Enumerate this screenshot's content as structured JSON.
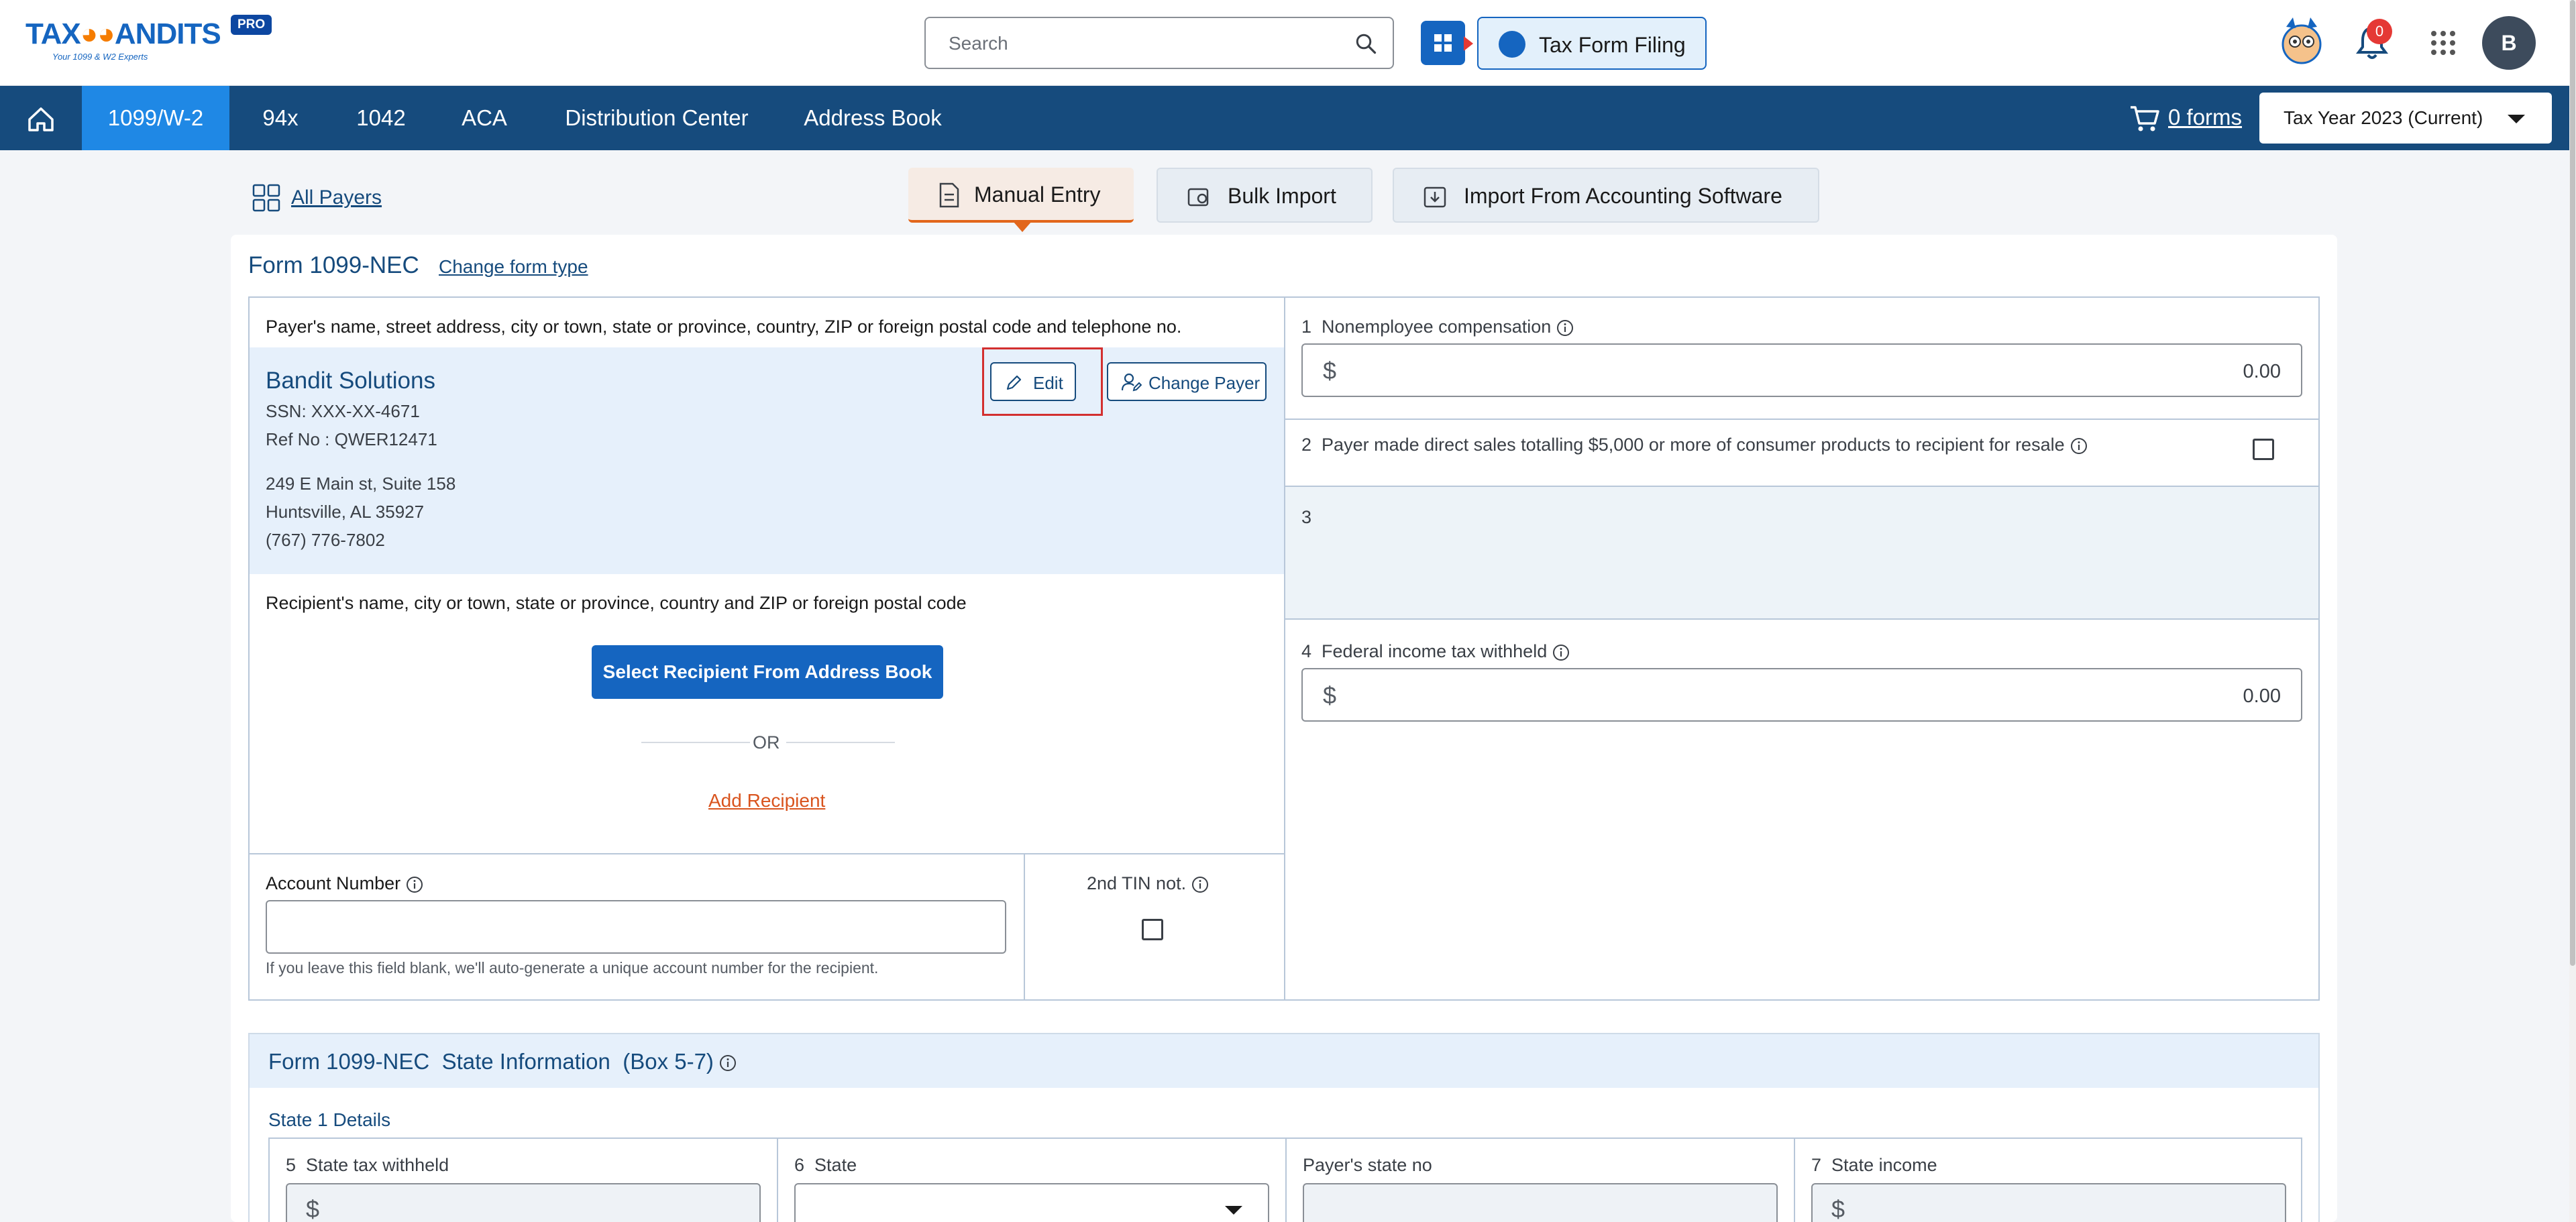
{
  "header": {
    "logo_text_left": "TAX",
    "logo_text_right": "ANDITS",
    "logo_tagline": "Your 1099 & W2 Experts",
    "pro_badge": "PRO",
    "search_placeholder": "Search",
    "tax_form_filing_label": "Tax Form Filing",
    "notification_count": "0",
    "avatar_initial": "B"
  },
  "nav": {
    "items": [
      {
        "label": "1099/W-2",
        "active": true
      },
      {
        "label": "94x"
      },
      {
        "label": "1042"
      },
      {
        "label": "ACA"
      },
      {
        "label": "Distribution Center"
      },
      {
        "label": "Address Book"
      }
    ],
    "cart_label": "0 forms",
    "tax_year": "Tax Year 2023 (Current)"
  },
  "toolbar": {
    "all_payers": "All Payers",
    "tabs": [
      {
        "label": "Manual Entry",
        "active": true
      },
      {
        "label": "Bulk Import"
      },
      {
        "label": "Import From Accounting Software"
      }
    ]
  },
  "form": {
    "title": "Form 1099-NEC",
    "change_type": "Change form type",
    "payer_section_label": "Payer's name, street address, city or town, state or province, country, ZIP or foreign postal code and telephone no.",
    "payer": {
      "name": "Bandit Solutions",
      "ssn": "SSN: XXX-XX-4671",
      "ref": "Ref No : QWER12471",
      "address1": "249 E Main st, Suite 158",
      "address2": "Huntsville, AL 35927",
      "phone": "(767) 776-7802"
    },
    "edit_label": "Edit",
    "change_payer_label": "Change Payer",
    "recipient_section_label": "Recipient's name, city or town, state or province, country and ZIP or foreign postal code",
    "select_recipient_label": "Select Recipient From Address Book",
    "or_label": "OR",
    "add_recipient_label": "Add Recipient",
    "account_number_label": "Account Number",
    "account_number_value": "",
    "account_number_hint": "If you leave this field blank, we'll auto-generate a unique account number for the recipient.",
    "second_tin_label": "2nd TIN not.",
    "box1": {
      "num": "1",
      "label": "Nonemployee compensation",
      "currency": "$",
      "value": "0.00"
    },
    "box2": {
      "num": "2",
      "label": "Payer made direct sales totalling $5,000 or more of consumer products to recipient for resale"
    },
    "box3": {
      "num": "3"
    },
    "box4": {
      "num": "4",
      "label": "Federal income tax withheld",
      "currency": "$",
      "value": "0.00"
    }
  },
  "state": {
    "title": "Form 1099-NEC  State Information  (Box 5-7)",
    "subtitle": "State 1 Details",
    "fields": [
      {
        "num": "5",
        "label": "State tax withheld",
        "currency": "$"
      },
      {
        "num": "6",
        "label": "State"
      },
      {
        "num": "",
        "label": "Payer's state no"
      },
      {
        "num": "7",
        "label": "State income",
        "currency": "$"
      }
    ]
  }
}
